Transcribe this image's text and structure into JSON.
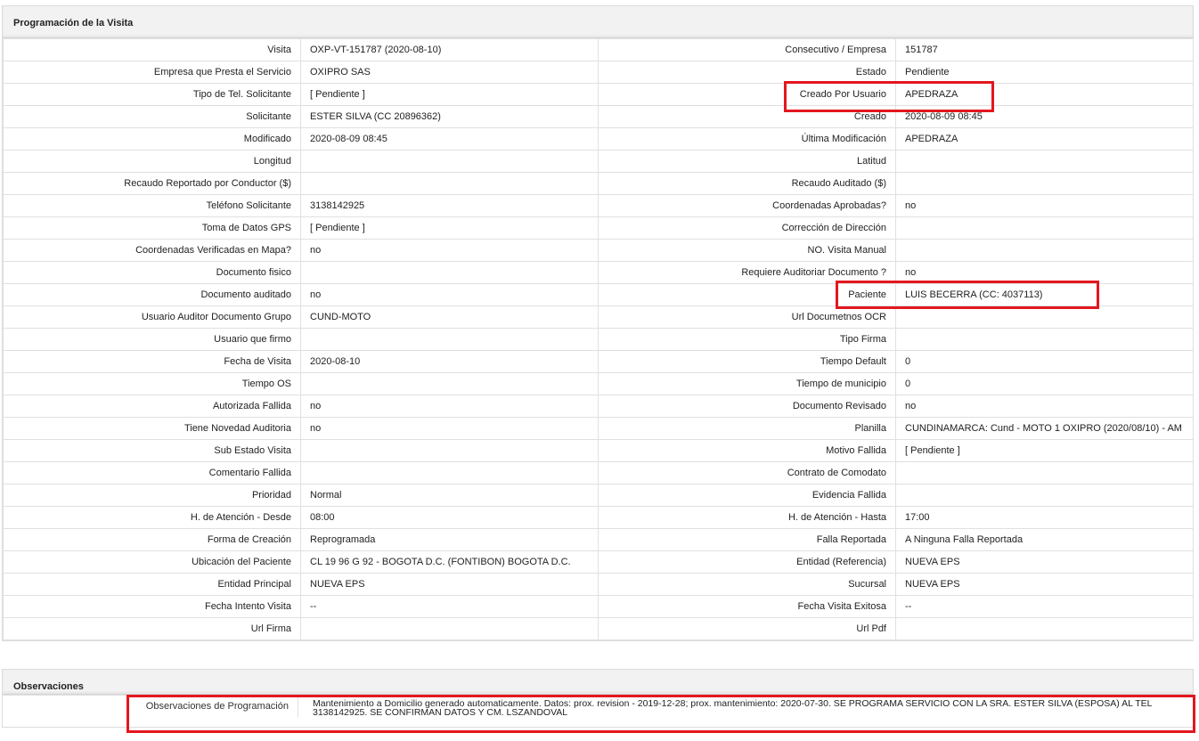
{
  "section_title": "Programación de la Visita",
  "rows": [
    {
      "left_label": "Visita",
      "left_value": "OXP-VT-151787 (2020-08-10)",
      "right_label": "Consecutivo / Empresa",
      "right_value": "151787"
    },
    {
      "left_label": "Empresa que Presta el Servicio",
      "left_value": "OXIPRO SAS",
      "right_label": "Estado",
      "right_value": "Pendiente"
    },
    {
      "left_label": "Tipo de Tel. Solicitante",
      "left_value": "[ Pendiente ]",
      "right_label": "Creado Por Usuario",
      "right_value": "APEDRAZA"
    },
    {
      "left_label": "Solicitante",
      "left_value": "ESTER SILVA (CC 20896362)",
      "right_label": "Creado",
      "right_value": "2020-08-09 08:45"
    },
    {
      "left_label": "Modificado",
      "left_value": "2020-08-09 08:45",
      "right_label": "Última Modificación",
      "right_value": " APEDRAZA"
    },
    {
      "left_label": "Longitud",
      "left_value": "",
      "right_label": "Latitud",
      "right_value": ""
    },
    {
      "left_label": "Recaudo Reportado por Conductor ($)",
      "left_value": "",
      "right_label": "Recaudo Auditado ($)",
      "right_value": ""
    },
    {
      "left_label": "Teléfono Solicitante",
      "left_value": "3138142925",
      "right_label": "Coordenadas Aprobadas?",
      "right_value": " no"
    },
    {
      "left_label": "Toma de Datos GPS",
      "left_value": "[ Pendiente ]",
      "right_label": "Corrección de Dirección",
      "right_value": ""
    },
    {
      "left_label": "Coordenadas Verificadas en Mapa?",
      "left_value": " no",
      "right_label": "NO. Visita Manual",
      "right_value": ""
    },
    {
      "left_label": "Documento fisico",
      "left_value": "",
      "right_label": "Requiere Auditoriar Documento ?",
      "right_value": " no"
    },
    {
      "left_label": "Documento auditado",
      "left_value": " no",
      "right_label": "Paciente",
      "right_value": "LUIS BECERRA (CC: 4037113)"
    },
    {
      "left_label": "Usuario Auditor Documento Grupo",
      "left_value": "CUND-MOTO",
      "right_label": "Url Documetnos OCR",
      "right_value": ""
    },
    {
      "left_label": "Usuario que firmo",
      "left_value": "",
      "right_label": "Tipo Firma",
      "right_value": ""
    },
    {
      "left_label": "Fecha de Visita",
      "left_value": " 2020-08-10",
      "right_label": "Tiempo Default",
      "right_value": "0"
    },
    {
      "left_label": "Tiempo OS",
      "left_value": "",
      "right_label": "Tiempo de municipio",
      "right_value": "0"
    },
    {
      "left_label": "Autorizada Fallida",
      "left_value": " no",
      "right_label": "Documento Revisado",
      "right_value": " no"
    },
    {
      "left_label": "Tiene Novedad Auditoria",
      "left_value": " no",
      "right_label": "Planilla",
      "right_value": "CUNDINAMARCA: Cund - MOTO 1 OXIPRO (2020/08/10) - AM"
    },
    {
      "left_label": "Sub Estado Visita",
      "left_value": "",
      "right_label": "Motivo Fallida",
      "right_value": "[ Pendiente ]"
    },
    {
      "left_label": "Comentario Fallida",
      "left_value": "",
      "right_label": "Contrato de Comodato",
      "right_value": ""
    },
    {
      "left_label": "Prioridad",
      "left_value": "Normal",
      "right_label": "Evidencia Fallida",
      "right_value": ""
    },
    {
      "left_label": "H. de Atención - Desde",
      "left_value": "08:00",
      "right_label": "H. de Atención - Hasta",
      "right_value": "17:00"
    },
    {
      "left_label": "Forma de Creación",
      "left_value": "Reprogramada",
      "right_label": "Falla Reportada",
      "right_value": "A Ninguna Falla Reportada"
    },
    {
      "left_label": "Ubicación del Paciente",
      "left_value": "CL 19 96 G 92 - BOGOTA D.C. (FONTIBON) BOGOTA D.C.",
      "right_label": "Entidad (Referencia)",
      "right_value": "NUEVA EPS"
    },
    {
      "left_label": "Entidad Principal",
      "left_value": "NUEVA EPS",
      "right_label": "Sucursal",
      "right_value": "NUEVA EPS"
    },
    {
      "left_label": "Fecha Intento Visita",
      "left_value": " --",
      "right_label": "Fecha Visita Exitosa",
      "right_value": " --"
    },
    {
      "left_label": "Url Firma",
      "left_value": "",
      "right_label": "Url Pdf",
      "right_value": ""
    }
  ],
  "observaciones": {
    "title": "Observaciones",
    "label": "Observaciones de Programación",
    "value": "Mantenimiento a Domicilio generado automaticamente. Datos: prox. revision - 2019-12-28; prox. mantenimiento: 2020-07-30. SE PROGRAMA SERVICIO CON LA SRA. ESTER SILVA (ESPOSA) AL TEL 3138142925. SE CONFIRMAN DATOS Y CM. LSZANDOVAL"
  },
  "colors": {
    "highlight": "#e3171f",
    "header_bg": "#f2f2f2",
    "border": "#e0e0e0"
  }
}
